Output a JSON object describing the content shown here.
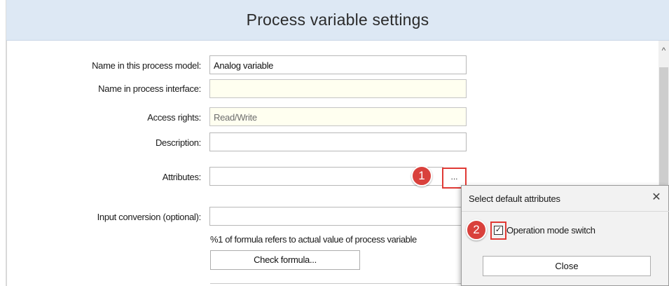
{
  "window": {
    "title": "Process variable settings"
  },
  "form": {
    "name_model_label": "Name in this process model:",
    "name_model_value": "Analog variable",
    "name_interface_label": "Name in process interface:",
    "name_interface_value": "",
    "access_rights_label": "Access rights:",
    "access_rights_value": "Read/Write",
    "description_label": "Description:",
    "description_value": "",
    "attributes_label": "Attributes:",
    "attributes_value": "",
    "attributes_button": "...",
    "input_conversion_label": "Input conversion (optional):",
    "input_conversion_value": "",
    "formula_hint": "%1 of formula refers to actual value of process variable",
    "check_formula_button": "Check formula..."
  },
  "callouts": {
    "badge_1": "1",
    "badge_2": "2"
  },
  "dialog": {
    "title": "Select default attributes",
    "close_x": "✕",
    "checkbox_label": "Operation mode switch",
    "checkbox_checked": true,
    "checkbox_mark": "✓",
    "close_button": "Close"
  },
  "scrollbar": {
    "up_arrow": "^"
  },
  "colors": {
    "title_bar": "#dde8f4",
    "highlight": "#e03a35",
    "badge": "#d9413c",
    "readonly_field": "#fffff0"
  }
}
